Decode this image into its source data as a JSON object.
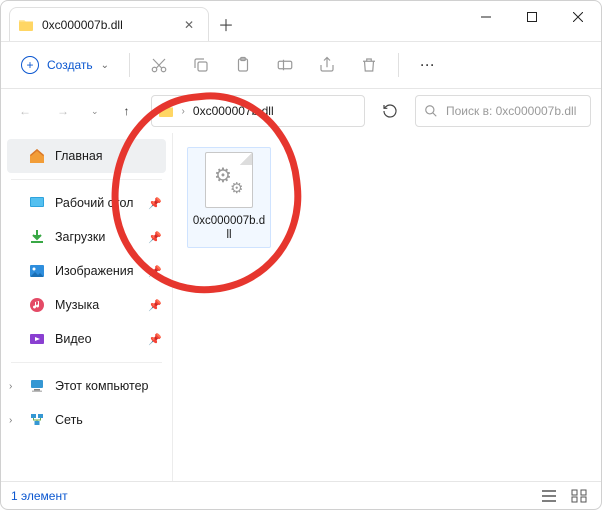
{
  "tab": {
    "title": "0xc000007b.dll"
  },
  "toolbar": {
    "create_label": "Создать"
  },
  "address": {
    "path": "0xc000007b.dll"
  },
  "search": {
    "placeholder": "Поиск в: 0xc000007b.dll"
  },
  "sidebar": {
    "home": "Главная",
    "desktop": "Рабочий стол",
    "downloads": "Загрузки",
    "pictures": "Изображения",
    "music": "Музыка",
    "videos": "Видео",
    "this_pc": "Этот компьютер",
    "network": "Сеть"
  },
  "file": {
    "name": "0xc000007b.dll"
  },
  "status": {
    "count": "1 элемент"
  }
}
